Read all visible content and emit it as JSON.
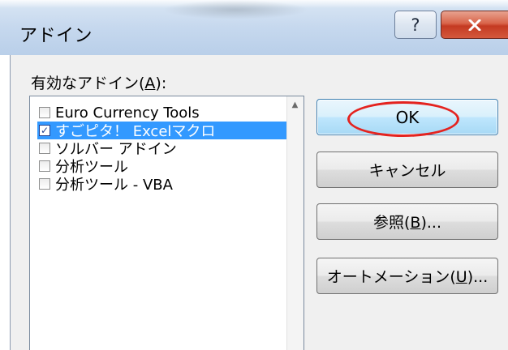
{
  "window": {
    "title": "アドイン",
    "help_glyph": "?"
  },
  "addins": {
    "list_label_prefix": "有効なアドイン(",
    "list_label_key": "A",
    "list_label_suffix": "):",
    "items": [
      {
        "label": "Euro Currency Tools",
        "checked": false,
        "selected": false
      },
      {
        "label": "すごピタ！ Excelマクロ",
        "checked": true,
        "selected": true
      },
      {
        "label": "ソルバー アドイン",
        "checked": false,
        "selected": false
      },
      {
        "label": "分析ツール",
        "checked": false,
        "selected": false
      },
      {
        "label": "分析ツール - VBA",
        "checked": false,
        "selected": false
      }
    ],
    "check_mark": "✓"
  },
  "buttons": {
    "ok": "OK",
    "cancel": "キャンセル",
    "browse_prefix": "参照(",
    "browse_key": "B",
    "browse_suffix": ")...",
    "automation_prefix": "オートメーション(",
    "automation_key": "U",
    "automation_suffix": ")..."
  },
  "colors": {
    "selection": "#3399ff",
    "close_button": "#c43a22",
    "annotation_oval": "#e4231f",
    "default_button": "#bee6fd"
  }
}
